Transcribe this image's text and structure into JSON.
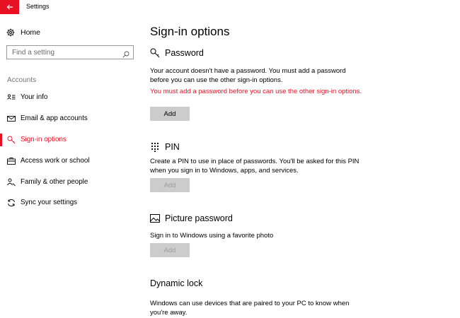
{
  "window": {
    "title": "Settings"
  },
  "sidebar": {
    "home_label": "Home",
    "search_placeholder": "Find a setting",
    "section_label": "Accounts",
    "items": [
      {
        "label": "Your info",
        "icon": "person-card-icon"
      },
      {
        "label": "Email & app accounts",
        "icon": "mail-icon"
      },
      {
        "label": "Sign-in options",
        "icon": "key-icon",
        "active": true
      },
      {
        "label": "Access work or school",
        "icon": "briefcase-icon"
      },
      {
        "label": "Family & other people",
        "icon": "people-icon"
      },
      {
        "label": "Sync your settings",
        "icon": "sync-icon"
      }
    ]
  },
  "main": {
    "title": "Sign-in options",
    "password": {
      "heading": "Password",
      "description": "Your account doesn't have a password. You must add a password before you can use the other sign-in options.",
      "warning": "You must add a password before you can use the other sign-in options.",
      "button": "Add"
    },
    "pin": {
      "heading": "PIN",
      "description": "Create a PIN to use in place of passwords. You'll be asked for this PIN when you sign in to Windows, apps, and services.",
      "button": "Add"
    },
    "picture_password": {
      "heading": "Picture password",
      "description": "Sign in to Windows using a favorite photo",
      "button": "Add"
    },
    "dynamic_lock": {
      "heading": "Dynamic lock",
      "description": "Windows can use devices that are paired to your PC to know when you're away."
    }
  },
  "colors": {
    "accent": "#e81123",
    "button": "#cccccc",
    "disabled_text": "#9c9c9c"
  }
}
